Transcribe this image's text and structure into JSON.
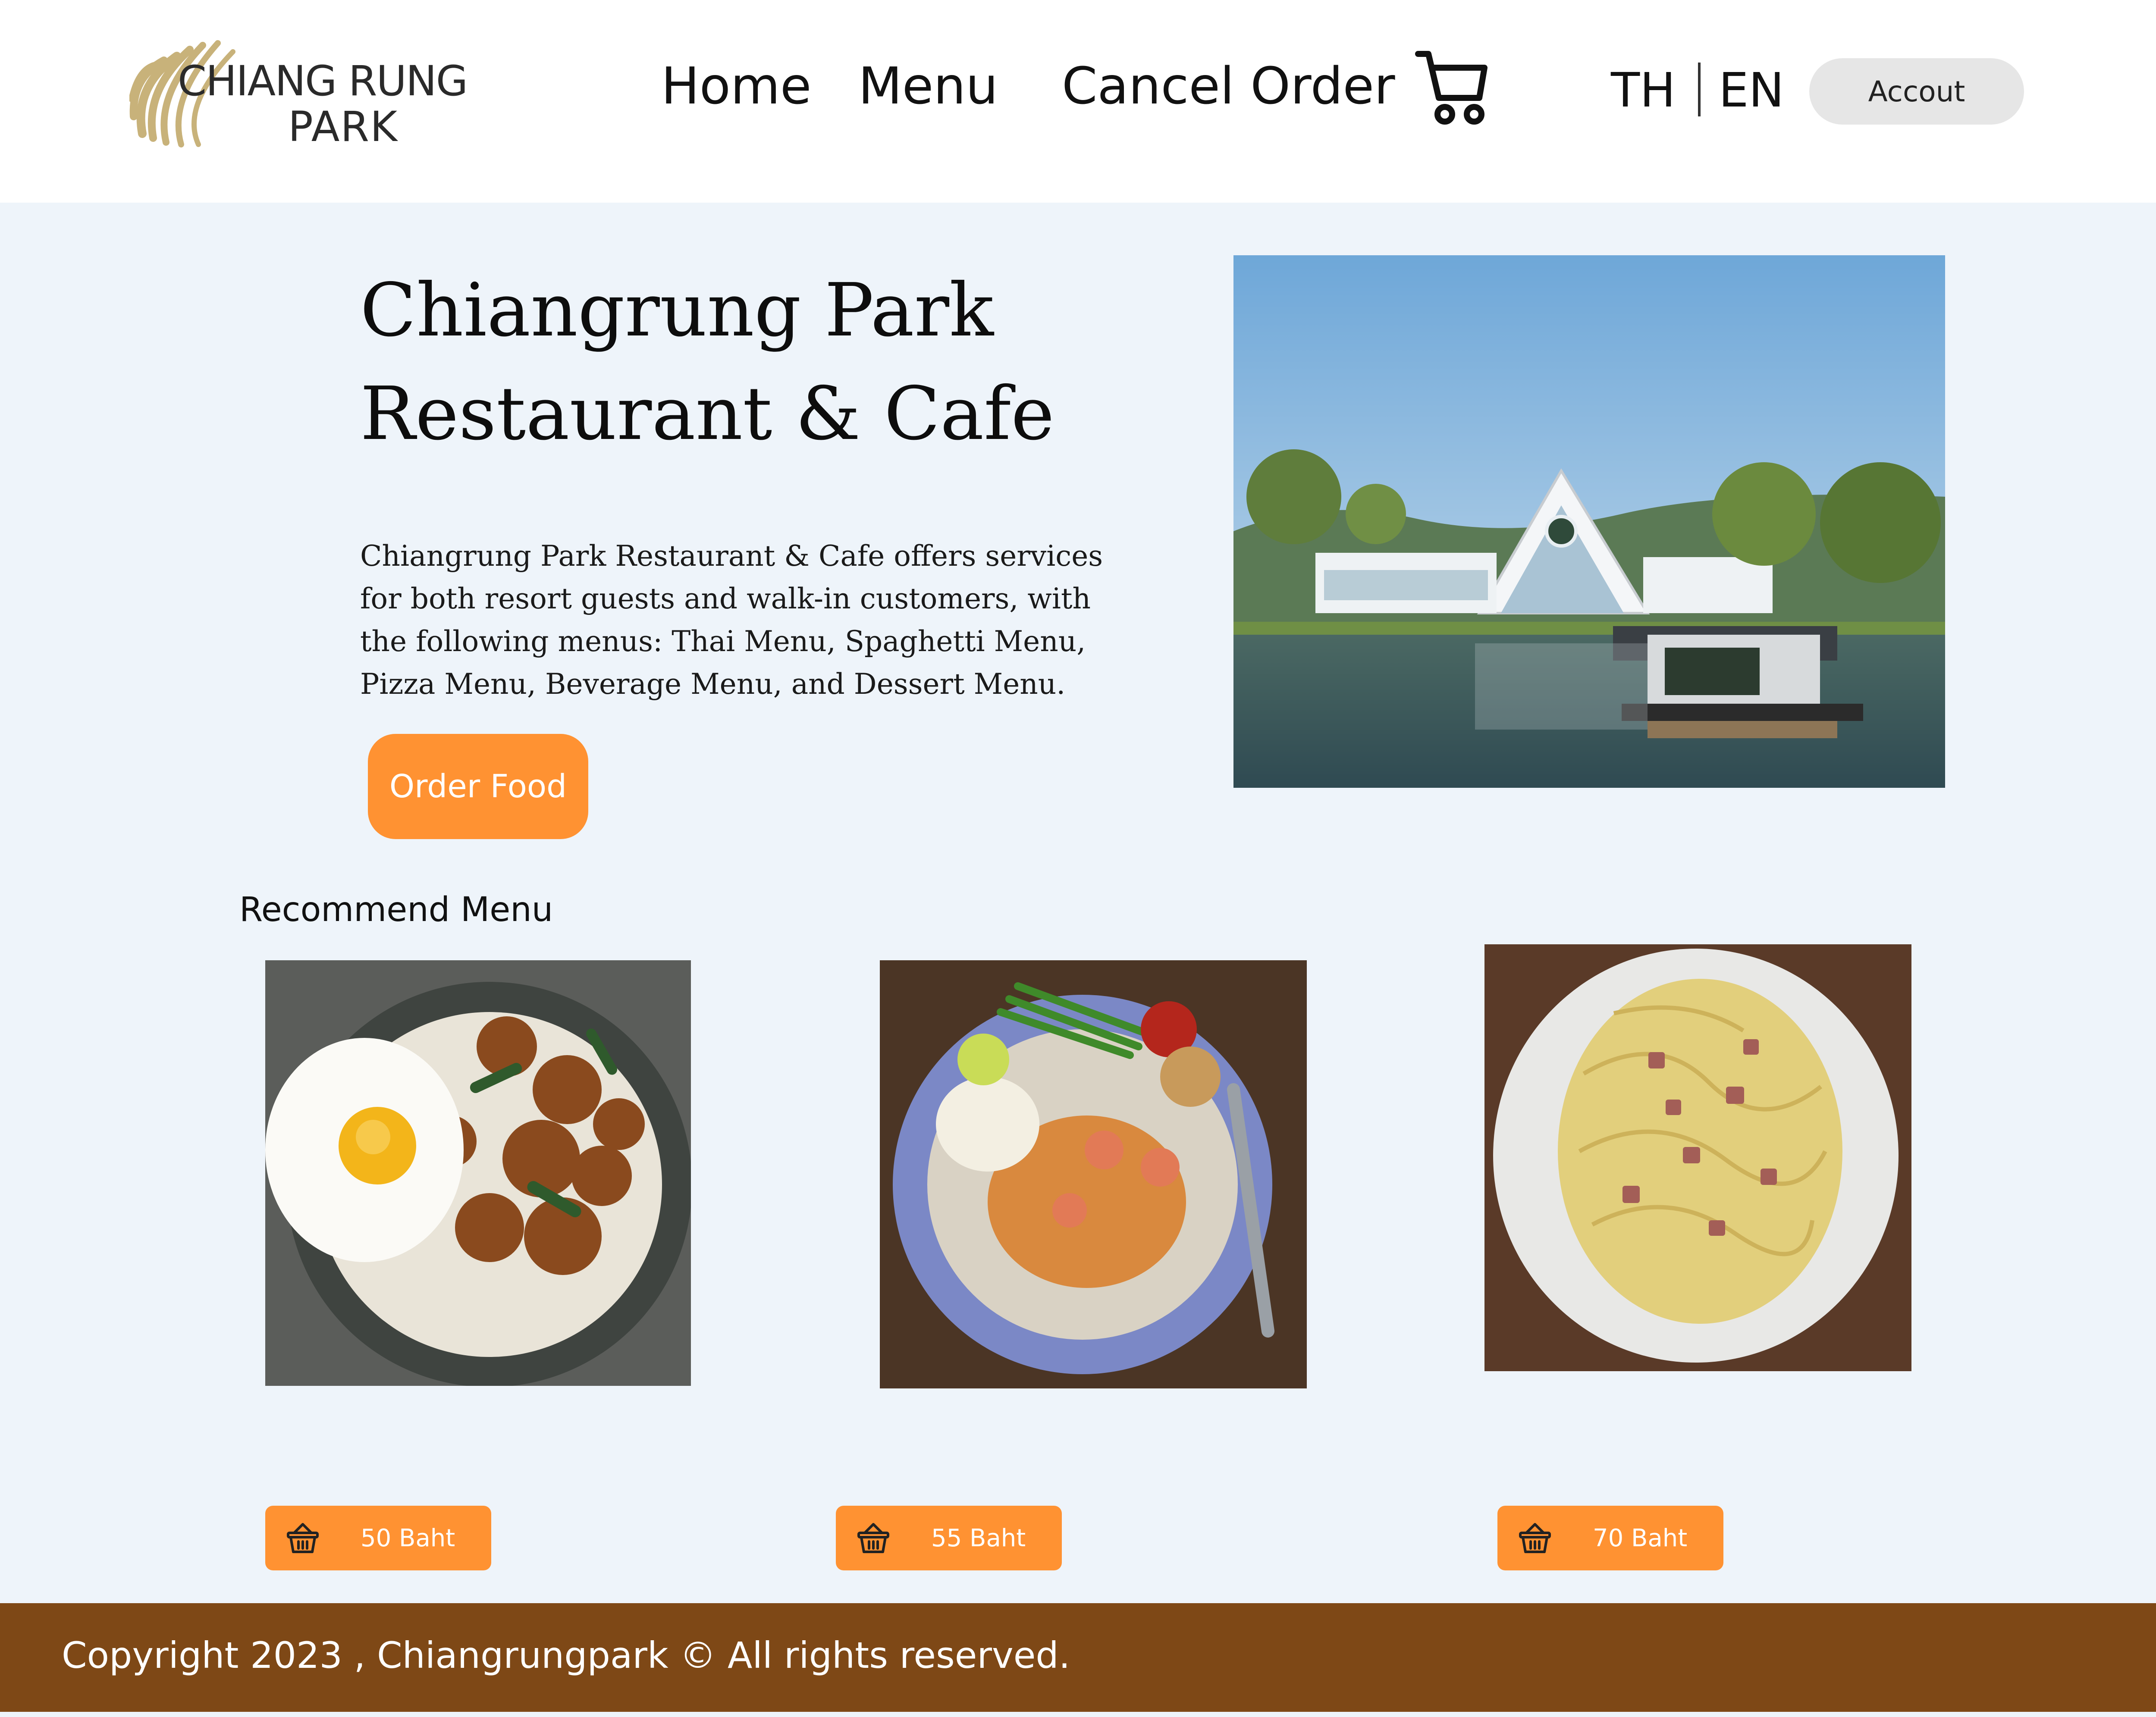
{
  "header": {
    "logo": {
      "line1": "CHIANG RUNG",
      "line2": "PARK"
    },
    "nav": [
      {
        "label": "Home"
      },
      {
        "label": "Menu"
      },
      {
        "label": "Cancel Order"
      }
    ],
    "cart_icon": "shopping-cart-icon",
    "languages": [
      "TH",
      "EN"
    ],
    "account_label": "Accout"
  },
  "hero": {
    "title_line1": "Chiangrung Park",
    "title_line2": "Restaurant & Cafe",
    "description": "Chiangrung Park Restaurant & Cafe offers services for both resort guests and walk-in customers, with the following menus: Thai Menu, Spaghetti Menu, Pizza Menu, Beverage Menu, and Dessert Menu.",
    "order_button": "Order Food"
  },
  "recommend": {
    "title": "Recommend Menu",
    "items": [
      {
        "price": "50 Baht",
        "icon": "basket-icon"
      },
      {
        "price": "55 Baht",
        "icon": "basket-icon"
      },
      {
        "price": "70 Baht",
        "icon": "basket-icon"
      }
    ]
  },
  "footer": {
    "copyright": "Copyright 2023 , Chiangrungpark © All rights reserved."
  },
  "colors": {
    "accent": "#ff9232",
    "footer": "#7e4816",
    "page_bg": "#eef4fa",
    "logo_gold": "#c8b27a"
  }
}
